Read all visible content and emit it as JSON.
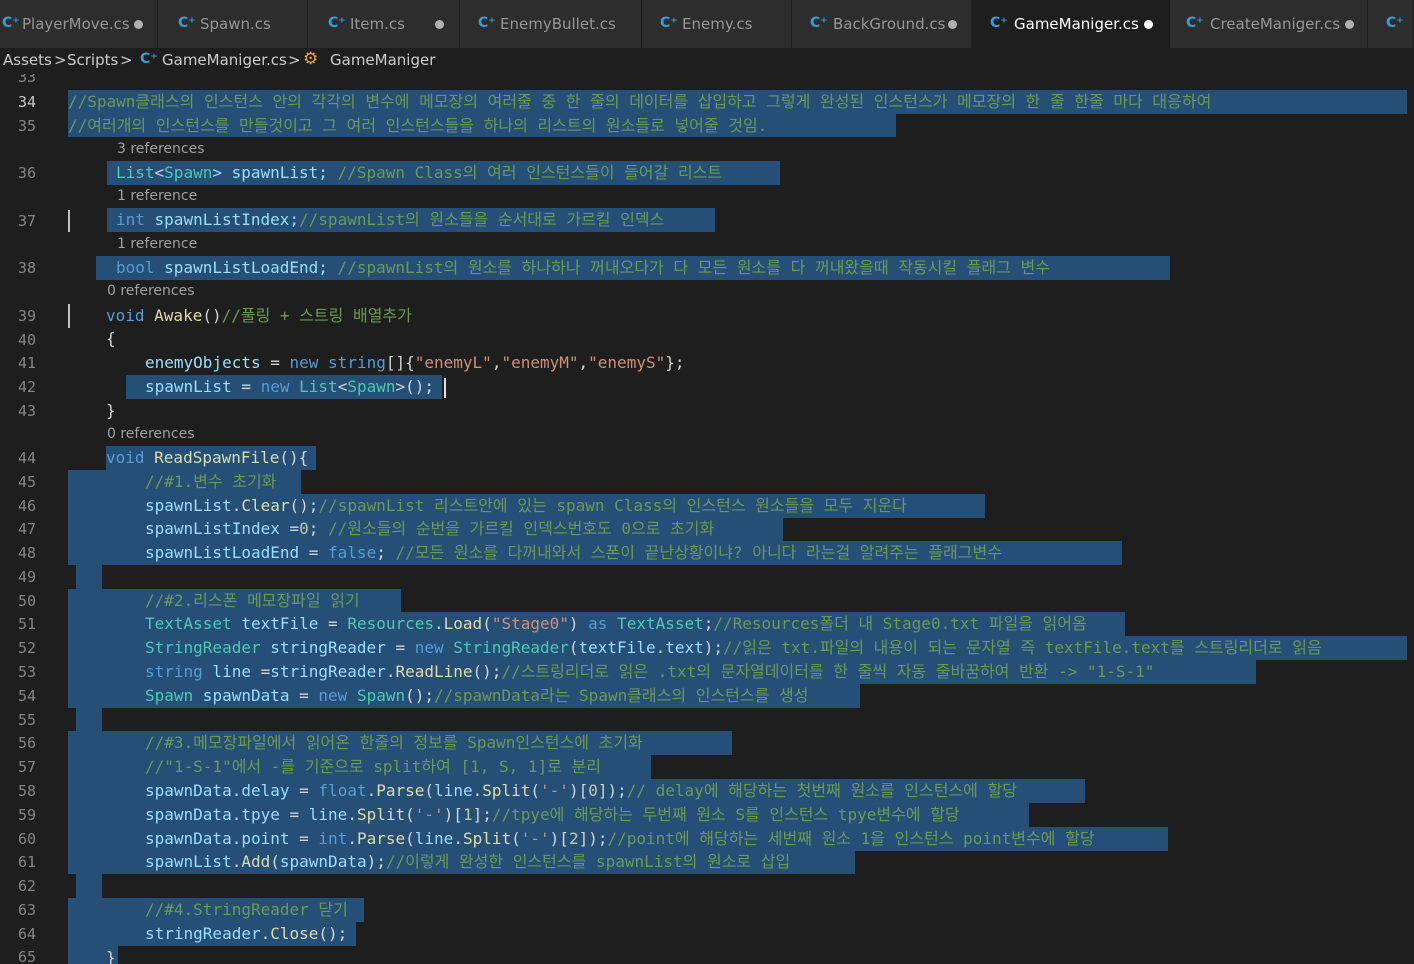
{
  "tabs": [
    {
      "label": "PlayerMove.cs",
      "icon": "csharp-file-icon",
      "modified": true,
      "active": false
    },
    {
      "label": "Spawn.cs",
      "icon": "csharp-file-icon",
      "modified": false,
      "active": false
    },
    {
      "label": "Item.cs",
      "icon": "csharp-file-icon",
      "modified": true,
      "active": false
    },
    {
      "label": "EnemyBullet.cs",
      "icon": "csharp-file-icon",
      "modified": false,
      "active": false
    },
    {
      "label": "Enemy.cs",
      "icon": "csharp-file-icon",
      "modified": false,
      "active": false
    },
    {
      "label": "BackGround.cs",
      "icon": "csharp-file-icon",
      "modified": true,
      "active": false
    },
    {
      "label": "GameManiger.cs",
      "icon": "csharp-file-icon",
      "modified": true,
      "active": true
    },
    {
      "label": "CreateManiger.cs",
      "icon": "csharp-file-icon",
      "modified": true,
      "active": false
    }
  ],
  "breadcrumb": {
    "assets": "Assets",
    "scripts": "Scripts",
    "file": "GameManiger.cs",
    "cls": "GameManiger",
    "separator": ">"
  },
  "codelens": {
    "l36": "3 references",
    "l37": "1 reference",
    "l38": "1 reference",
    "l39": "0 references",
    "l44": "0 references"
  },
  "line_numbers": [
    "33",
    "34",
    "35",
    "36",
    "37",
    "38",
    "39",
    "40",
    "41",
    "42",
    "43",
    "44",
    "45",
    "46",
    "47",
    "48",
    "49",
    "50",
    "51",
    "52",
    "53",
    "54",
    "55",
    "56",
    "57",
    "58",
    "59",
    "60",
    "61",
    "62",
    "63",
    "64",
    "65"
  ],
  "code": {
    "l34": "//Spawn클래스의 인스턴스 안의 각각의 변수에 메모장의 여러줄 중 한 줄의 데이터를 삽입하고 그렇게 완성된 인스턴스가 메모장의 한 줄 한줄 마다 대응하여",
    "l35": "//여러개의 인스턴스를 만들것이고 그 여러 인스턴스들을 하나의 리스트의 원소들로 넣어줄 것임.",
    "l36": {
      "t1": "List",
      "t2": "<",
      "t3": "Spawn",
      "t4": "> spawnList;",
      "c": " //Spawn Class의 여러 인스턴스들이 들어갈 리스트"
    },
    "l37": {
      "k": "int",
      "v": " spawnListIndex;",
      "c": "//spawnList의 원소들을 순서대로 가르킬 인덱스"
    },
    "l38": {
      "k": "bool",
      "v": " spawnListLoadEnd;",
      "c": " //spawnList의 원소를 하나하나 꺼내오다가 다 모든 원소를 다 꺼내왔을때 작동시킬 플래그 변수"
    },
    "l39": {
      "k": "void",
      "f": " Awake",
      "p": "()",
      "c": "//풀링 + 스트링 배열추가"
    },
    "l40": "{",
    "l41": {
      "v": "enemyObjects",
      "o": " = ",
      "k1": "new",
      "k2": " string",
      "p": "[]{",
      "s1": "\"enemyL\"",
      "c1": ",",
      "s2": "\"enemyM\"",
      "c2": ",",
      "s3": "\"enemyS\"",
      "e": "};"
    },
    "l42": {
      "v": "spawnList",
      "o": " = ",
      "k": "new",
      "t": " List",
      "lt": "<",
      "t2": "Spawn",
      "e": ">();"
    },
    "l43": "}",
    "l44": {
      "k": "void",
      "f": " ReadSpawnFile",
      "p": "(){"
    },
    "l45": "//#1.변수 초기화",
    "l46": {
      "v": "spawnList",
      "d": ".",
      "f": "Clear",
      "p": "();",
      "c": "//spawnList 리스트안에 있는 spawn Class의 인스턴스 원소들을 모두 지운다"
    },
    "l47": {
      "v": "spawnListIndex",
      "o": " =",
      "n": "0",
      "p": ";",
      "c": " //원소들의 순번을 가르킬 인덱스번호도 0으로 초기화"
    },
    "l48": {
      "v": "spawnListLoadEnd",
      "o": " = ",
      "k": "false",
      "p": ";",
      "c": " //모든 원소를 다꺼내와서 스폰이 끝난상황이냐? 아니다 라는걸 알려주는 플래그변수"
    },
    "l50": "//#2.리스폰 메모장파일 읽기",
    "l51": {
      "t": "TextAsset",
      "v": " textFile",
      "o": " = ",
      "t2": "Resources",
      "d": ".",
      "f": "Load",
      "p1": "(",
      "s": "\"Stage0\"",
      "p2": ") ",
      "k": "as",
      "t3": " TextAsset",
      "p3": ";",
      "c": "//Resources폴더 내 Stage0.txt 파일을 읽어옴"
    },
    "l52": {
      "t": "StringReader",
      "v": " stringReader",
      "o": " = ",
      "k": "new",
      "t2": " StringReader",
      "p1": "(",
      "v2": "textFile",
      "d": ".",
      "v3": "text",
      "p2": ");",
      "c": "//읽은 txt.파일의 내용이 되는 문자열 즉 textFile.text를 스트링리더로 읽음"
    },
    "l53": {
      "k": "string",
      "v": " line",
      "o": " =",
      "v2": "stringReader",
      "d": ".",
      "f": "ReadLine",
      "p": "();",
      "c": "//스트링리더로 읽은 .txt의 문자열데이터를 한 줄씩 자동 줄바꿈하여 반환 -> \"1-S-1\""
    },
    "l54": {
      "t": "Spawn",
      "v": " spawnData",
      "o": " = ",
      "k": "new",
      "t2": " Spawn",
      "p": "();",
      "c": "//spawnData라는 Spawn클래스의 인스턴스를 생성"
    },
    "l56": "//#3.메모장파일에서 읽어온 한줄의 정보를 Spawn인스턴스에 초기화",
    "l57": "//\"1-S-1\"에서 -를 기준으로 split하여 [1, S, 1]로 분리",
    "l58": {
      "v": "spawnData",
      "d": ".",
      "v2": "delay",
      "o": " = ",
      "k": "float",
      "d2": ".",
      "f": "Parse",
      "p1": "(",
      "v3": "line",
      "d3": ".",
      "f2": "Split",
      "p2": "(",
      "s": "'-'",
      "p3": ")[",
      "n": "0",
      "p4": "]);",
      "c": "// delay에 해당하는 첫번째 원소를 인스턴스에 할당"
    },
    "l59": {
      "v": "spawnData",
      "d": ".",
      "v2": "tpye",
      "o": " = ",
      "v3": "line",
      "d2": ".",
      "f": "Split",
      "p1": "(",
      "s": "'-'",
      "p2": ")[",
      "n": "1",
      "p3": "];",
      "c": "//tpye에 해당하는 두번째 원소 S를 인스턴스 tpye변수에 할당"
    },
    "l60": {
      "v": "spawnData",
      "d": ".",
      "v2": "point",
      "o": " = ",
      "k": "int",
      "d2": ".",
      "f": "Parse",
      "p1": "(",
      "v3": "line",
      "d3": ".",
      "f2": "Split",
      "p2": "(",
      "s": "'-'",
      "p3": ")[",
      "n": "2",
      "p4": "]);",
      "c": "//point에 해당하는 세번째 원소 1을 인스턴스 point변수에 할당"
    },
    "l61": {
      "v": "spawnList",
      "d": ".",
      "f": "Add",
      "p1": "(",
      "v2": "spawnData",
      "p2": ");",
      "c": "//이렇게 완성한 인스턴스를 spawnList의 원소로 삽입"
    },
    "l63": "//#4.StringReader 닫기",
    "l64": {
      "v": "stringReader",
      "d": ".",
      "f": "Close",
      "p": "();"
    },
    "l65": "}"
  },
  "colors": {
    "editor_bg": "#1e1e1e",
    "selection": "#264f78",
    "keyword": "#569cd6",
    "type": "#4ec9b0",
    "function": "#dcdcaa",
    "variable": "#9cdcfe",
    "string": "#ce9178",
    "comment": "#6a9955",
    "number": "#b5cea8",
    "csharp_icon": "#2ba3e0"
  }
}
